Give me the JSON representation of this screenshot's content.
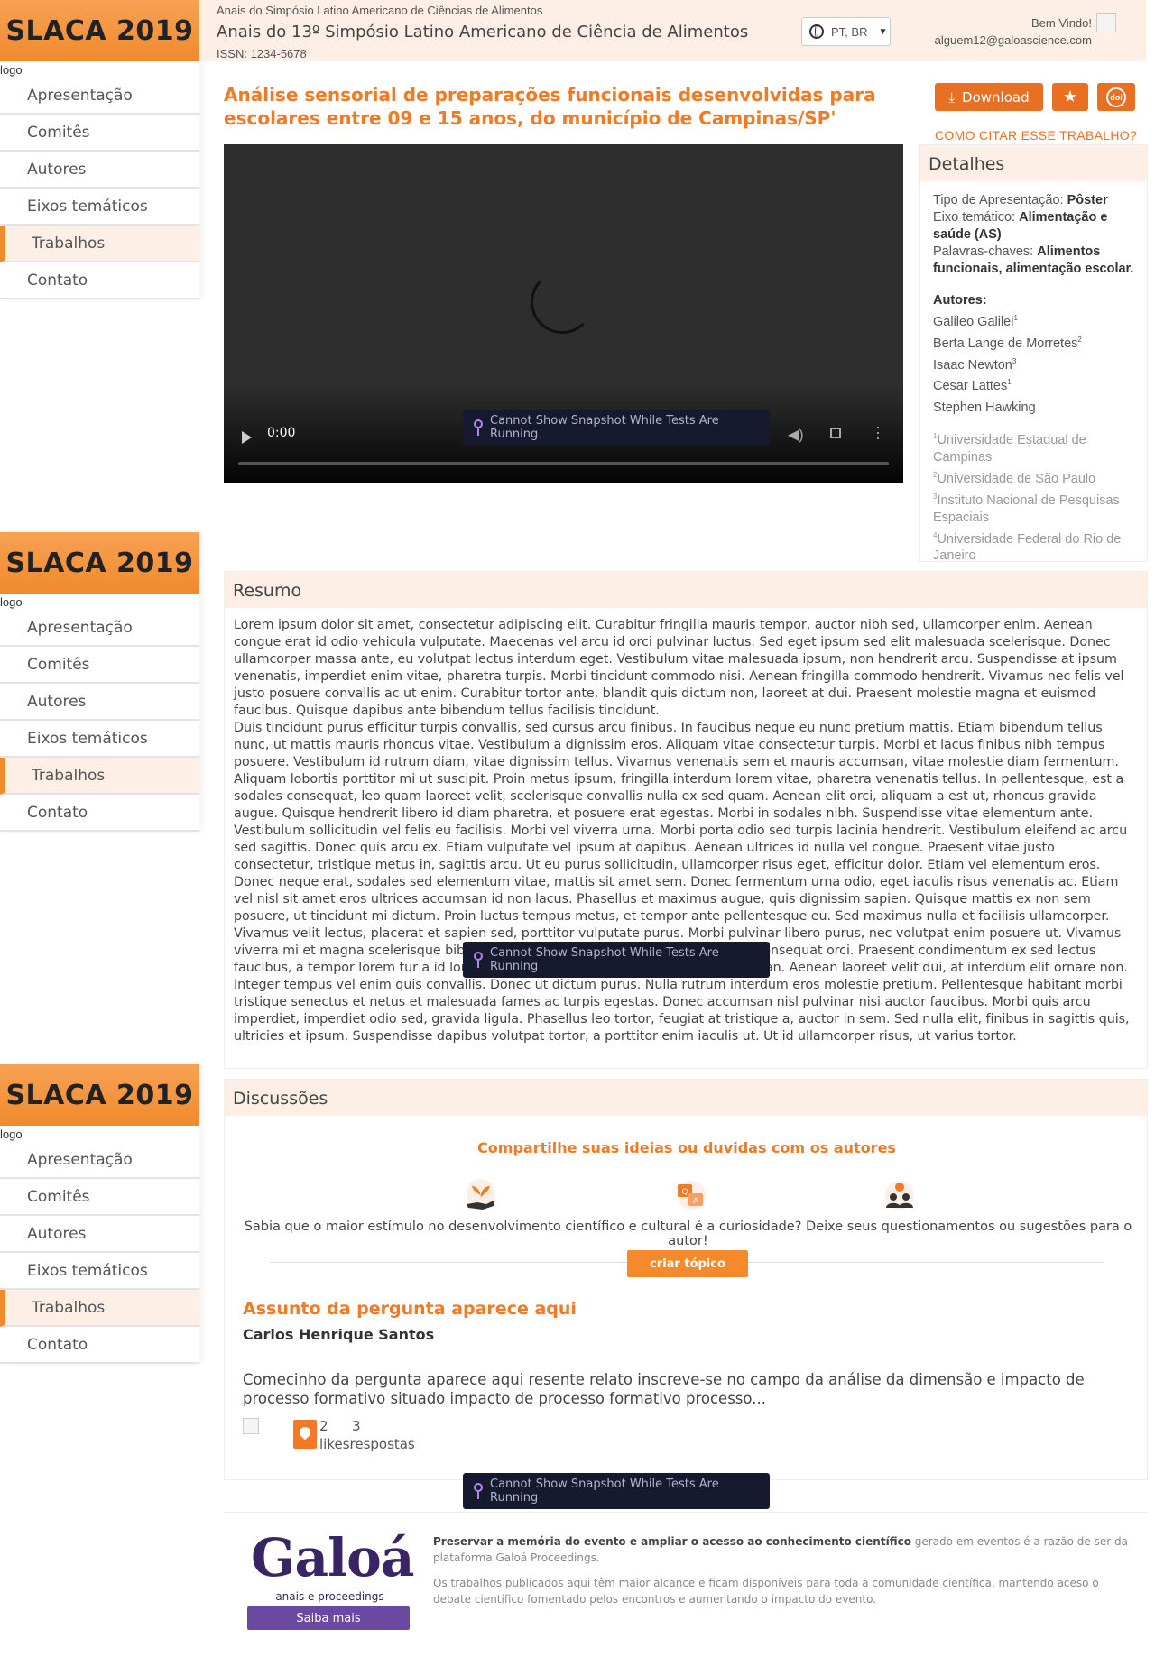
{
  "sidebar": {
    "event_title": "SLACA 2019",
    "logo_alt": "logo",
    "items": [
      {
        "label": "Apresentação",
        "active": false
      },
      {
        "label": "Comitês",
        "active": false
      },
      {
        "label": "Autores",
        "active": false
      },
      {
        "label": "Eixos temáticos",
        "active": false
      },
      {
        "label": "Trabalhos",
        "active": true
      },
      {
        "label": "Contato",
        "active": false
      }
    ]
  },
  "header": {
    "breadcrumb": "Anais do Simpósio Latino Americano de Ciências de Alimentos",
    "title": "Anais do 13º Simpósio Latino Americano de Ciência de Alimentos",
    "issn": "ISSN: 1234-5678",
    "language": "PT, BR",
    "welcome": "Bem Vindo!",
    "user_email": "alguem12@galoascience.com"
  },
  "paper": {
    "title": "Análise sensorial de preparações funcionais desenvolvidas para escolares entre 09 e 15 anos, do município de Campinas/SP'",
    "download_label": "Download",
    "doi_label": "doi",
    "cite_link": "COMO CITAR ESSE TRABALHO?"
  },
  "video": {
    "time": "0:00",
    "toast": "Cannot Show Snapshot While Tests Are Running"
  },
  "details": {
    "heading": "Detalhes",
    "presentation_type_label": "Tipo de Apresentação:",
    "presentation_type": "Pôster",
    "axis_label": "Eixo temático:",
    "axis": "Alimentação e saúde (AS)",
    "keywords_label": "Palavras-chaves:",
    "keywords": "Alimentos funcionais, alimentação escolar.",
    "authors_heading": "Autores:",
    "authors": [
      {
        "name": "Galileo Galilei",
        "sup": "1"
      },
      {
        "name": "Berta Lange de Morretes",
        "sup": "2"
      },
      {
        "name": "Isaac Newton",
        "sup": "3"
      },
      {
        "name": "Cesar Lattes",
        "sup": "1"
      },
      {
        "name": "Stephen Hawking",
        "sup": ""
      }
    ],
    "affiliations": [
      {
        "sup": "1",
        "name": "Universidade Estadual de Campinas"
      },
      {
        "sup": "2",
        "name": "Universidade de São Paulo"
      },
      {
        "sup": "3",
        "name": "Instituto Nacional de Pesquisas Espaciais"
      },
      {
        "sup": "4",
        "name": "Universidade Federal do Rio de Janeiro"
      }
    ]
  },
  "resumo": {
    "heading": "Resumo",
    "paragraph1": "Lorem ipsum dolor sit amet, consectetur adipiscing elit. Curabitur fringilla mauris tempor, auctor nibh sed, ullamcorper enim. Aenean congue erat id odio vehicula vulputate. Maecenas vel arcu id orci pulvinar luctus. Sed eget ipsum sed elit malesuada scelerisque. Donec ullamcorper massa ante, eu volutpat lectus interdum eget. Vestibulum vitae malesuada ipsum, non hendrerit arcu. Suspendisse at ipsum venenatis, imperdiet enim vitae, pharetra turpis. Morbi tincidunt commodo nisi. Aenean fringilla commodo hendrerit. Vivamus nec felis vel justo posuere convallis ac ut enim. Curabitur tortor ante, blandit quis dictum non, laoreet at dui. Praesent molestie magna et euismod faucibus. Quisque dapibus ante bibendum tellus facilisis tincidunt.",
    "paragraph2": "Duis tincidunt purus efficitur turpis convallis, sed cursus arcu finibus. In faucibus neque eu nunc pretium mattis. Etiam bibendum tellus nunc, ut mattis mauris rhoncus vitae. Vestibulum a dignissim eros. Aliquam vitae consectetur turpis. Morbi et lacus finibus nibh tempus posuere. Vestibulum id rutrum diam, vitae dignissim tellus. Vivamus venenatis sem et mauris accumsan, vitae molestie diam fermentum. Aliquam lobortis porttitor mi ut suscipit. Proin metus ipsum, fringilla interdum lorem vitae, pharetra venenatis tellus. In pellentesque, est a sodales consequat, leo quam laoreet velit, scelerisque convallis nulla ex sed quam. Aenean elit orci, aliquam a est ut, rhoncus gravida augue. Quisque hendrerit libero id diam pharetra, et posuere erat egestas. Morbi in sodales nibh. Suspendisse vitae elementum ante. Vestibulum sollicitudin vel felis eu facilisis. Morbi vel viverra urna. Morbi porta odio sed turpis lacinia hendrerit. Vestibulum eleifend ac arcu sed sagittis. Donec quis arcu ex. Etiam vulputate vel ipsum at dapibus. Aenean ultrices id nulla vel congue. Praesent vitae justo consectetur, tristique metus in, sagittis arcu. Ut eu purus sollicitudin, ullamcorper risus eget, efficitur dolor. Etiam vel elementum eros. Donec neque erat, sodales sed elementum vitae, mattis sit amet sem. Donec fermentum urna odio, eget iaculis risus venenatis ac. Etiam vel nisl sit amet eros ultrices accumsan id non lacus. Phasellus et maximus augue, quis dignissim sapien. Quisque mattis ex non sem posuere, ut tincidunt mi dictum. Proin luctus tempus metus, et tempor ante pellentesque eu. Sed maximus nulla et facilisis ullamcorper. Vivamus velit lectus, placerat et sapien sed, porttitor vulputate purus. Morbi pulvinar libero purus, nec volutpat enim posuere ut. Vivamus viverra mi et magna scelerisque bibendum. Vivamus lacinia elit sem, lacus, eget consequat orci. Praesent condimentum ex sed lectus faucibus, a tempor lorem tur a id lorem. Duis ultrices laoreet est vulputate accumsan. Aenean laoreet velit dui, at interdum elit ornare non. Integer tempus vel enim quis convallis. Donec ut dictum purus. Nulla rutrum interdum eros molestie pretium. Pellentesque habitant morbi tristique senectus et netus et malesuada fames ac turpis egestas. Donec accumsan nisl pulvinar nisi auctor faucibus. Morbi quis arcu imperdiet, imperdiet odio sed, gravida ligula. Phasellus leo tortor, feugiat at tristique a, auctor in sem. Sed nulla elit, finibus in sagittis quis, ultricies et ipsum. Suspendisse dapibus volutpat tortor, a porttitor enim iaculis ut. Ut id ullamcorper risus, ut varius tortor."
  },
  "discussions": {
    "heading": "Discussões",
    "cta": "Compartilhe suas ideias ou duvidas com os autores",
    "description": "Sabia que o maior estímulo no desenvolvimento científico e cultural é a curiosidade? Deixe seus questionamentos ou sugestões para o autor!",
    "create_topic": "criar tópico",
    "question": {
      "subject": "Assunto da pergunta aparece aqui",
      "author": "Carlos Henrique Santos",
      "body": "Comecinho da pergunta aparece aqui resente relato inscreve-se no campo da análise da dimensão e impacto de processo formativo situado impacto de processo formativo processo...",
      "likes": "2",
      "replies": "3",
      "likes_label": "likes",
      "replies_label": "respostas"
    }
  },
  "footer": {
    "logo_text": "Galoá",
    "logo_sub": "anais e proceedings",
    "saiba_mais": "Saiba mais",
    "text_bold": "Preservar a memória do evento e ampliar o acesso ao conhecimento científico",
    "text_rest": " gerado em eventos é a razão de ser da plataforma Galoá Proceedings.",
    "text2": "Os trabalhos publicados aqui têm maior alcance e ficam disponíveis para toda a comunidade científica, mantendo aceso o debate científico fomentado pelos encontros e aumentando o impacto do evento."
  },
  "colors": {
    "accent": "#f07a25",
    "header_bg": "#fdeee6",
    "galoa_purple": "#3a2564"
  }
}
